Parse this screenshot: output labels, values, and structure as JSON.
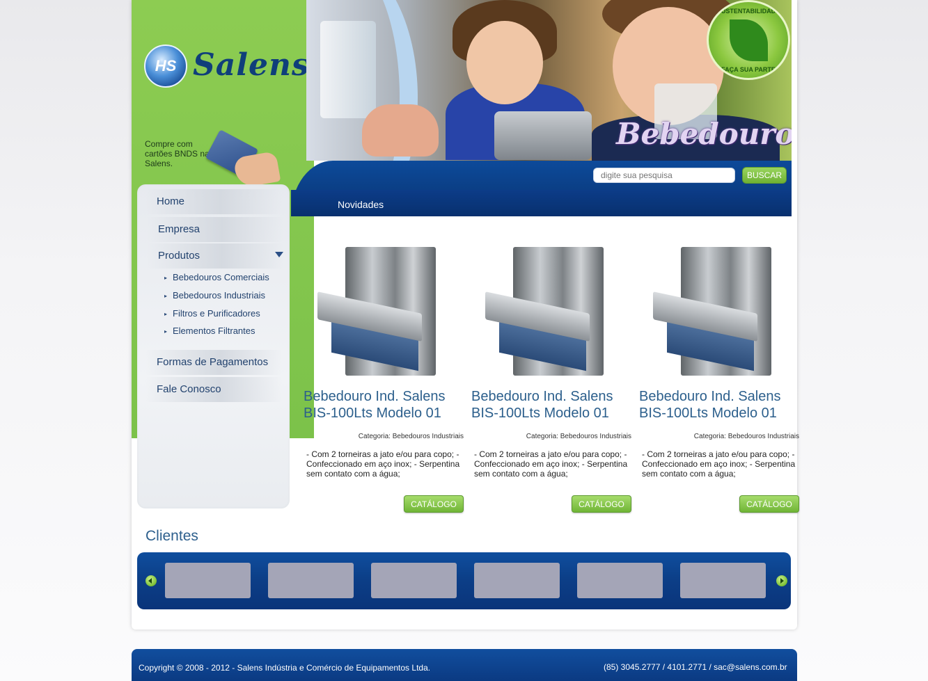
{
  "brand": {
    "logo_initials": "HS",
    "name": "Salens",
    "bnds_promo": "Compre com cartões BNDS na Salens."
  },
  "banner": {
    "title": "Bebedouros",
    "badge_text_top": "SUSTENTABILIDADE",
    "badge_text_bottom": "FAÇA SUA PARTE"
  },
  "search": {
    "placeholder": "digite sua pesquisa",
    "button_label": "BUSCAR"
  },
  "section_title": "Novidades",
  "menu": {
    "items": [
      {
        "label": "Home"
      },
      {
        "label": "Empresa"
      },
      {
        "label": "Produtos"
      },
      {
        "label": "Formas de Pagamentos"
      },
      {
        "label": "Fale Conosco"
      }
    ],
    "subitems": [
      {
        "label": "Bebedouros Comerciais"
      },
      {
        "label": "Bebedouros Industriais"
      },
      {
        "label": "Filtros e Purificadores"
      },
      {
        "label": "Elementos Filtrantes"
      }
    ]
  },
  "products": [
    {
      "title": "Bebedouro Ind. Salens BIS-100Lts Modelo 01",
      "category": "Categoria: Bebedouros Industriais",
      "description": "- Com 2 torneiras a jato e/ou para copo; - Confeccionado em aço inox; - Serpentina sem contato com a água;",
      "button_label": "CATÁLOGO"
    },
    {
      "title": "Bebedouro Ind. Salens BIS-100Lts Modelo 01",
      "category": "Categoria: Bebedouros Industriais",
      "description": "- Com 2 torneiras a jato e/ou para copo; - Confeccionado em aço inox; - Serpentina sem contato com a água;",
      "button_label": "CATÁLOGO"
    },
    {
      "title": "Bebedouro Ind. Salens BIS-100Lts Modelo 01",
      "category": "Categoria: Bebedouros Industriais",
      "description": "- Com 2 torneiras a jato e/ou para copo; - Confeccionado em aço inox; - Serpentina sem contato com a água;",
      "button_label": "CATÁLOGO"
    }
  ],
  "clients": {
    "title": "Clientes"
  },
  "footer": {
    "copyright": "Copyright © 2008 - 2012 - Salens Indústria e Comércio de Equipamentos Ltda.",
    "contact": "(85) 3045.2777 / 4101.2771 / sac@salens.com.br"
  },
  "colors": {
    "brand_green": "#7cc24a",
    "brand_blue": "#0b3f86",
    "title_blue": "#2c5f8c",
    "button_green": "#70b536"
  }
}
